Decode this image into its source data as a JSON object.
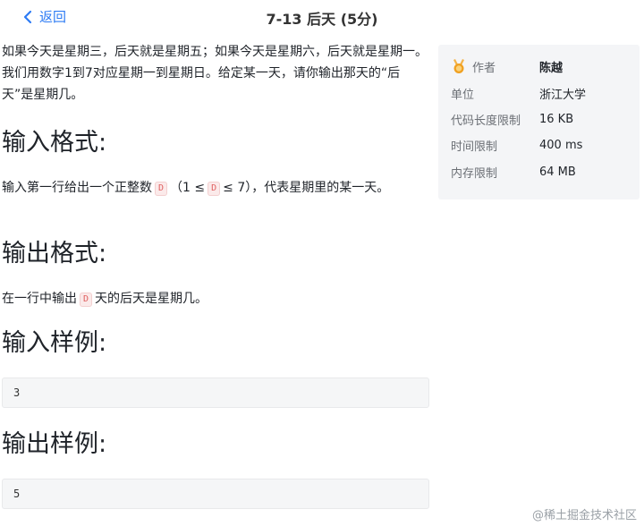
{
  "header": {
    "back_label": "返回",
    "title": "7-13 后天 (5分)"
  },
  "problem": {
    "description": "如果今天是星期三，后天就是星期五；如果今天是星期六，后天就是星期一。我们用数字1到7对应星期一到星期日。给定某一天，请你输出那天的“后天”是星期几。",
    "input_heading": "输入格式:",
    "input_text_pre": "输入第一行给出一个正整数",
    "input_var": "D",
    "input_text_mid": "（1 ≤",
    "input_var2": "D",
    "input_text_post": "≤ 7），代表星期里的某一天。",
    "output_heading": "输出格式:",
    "output_text_pre": "在一行中输出",
    "output_var": "D",
    "output_text_post": "天的后天是星期几。",
    "sample_in_heading": "输入样例:",
    "sample_in_value": "3",
    "sample_out_heading": "输出样例:",
    "sample_out_value": "5"
  },
  "info": {
    "author_label": "作者",
    "author_value": "陈越",
    "unit_label": "单位",
    "unit_value": "浙江大学",
    "code_label": "代码长度限制",
    "code_value": "16 KB",
    "time_label": "时间限制",
    "time_value": "400 ms",
    "memory_label": "内存限制",
    "memory_value": "64 MB"
  },
  "watermark": "@稀土掘金技术社区",
  "colors": {
    "accent": "#2d7bf4",
    "panel": "#f4f5f7",
    "medal": "#f0a020"
  }
}
